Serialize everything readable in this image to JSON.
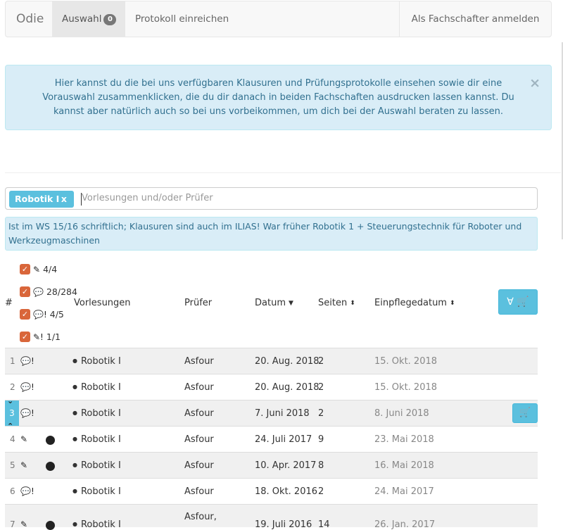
{
  "navbar": {
    "brand": "Odie",
    "auswahl_label": "Auswahl",
    "auswahl_count": "0",
    "protokoll_label": "Protokoll einreichen",
    "fachschafter_label": "Als Fachschafter anmelden"
  },
  "alert": {
    "text": "Hier kannst du die bei uns verfügbaren Klausuren und Prüfungsprotokolle einsehen sowie dir eine Vorauswahl zusammenklicken, die du dir danach in beiden Fachschaften ausdrucken lassen kannst. Du kannst aber natürlich auch so bei uns vorbeikommen, um dich bei der Auswahl beraten zu lassen.",
    "close": "×"
  },
  "search": {
    "tag_label": "Robotik I",
    "tag_remove": "x",
    "placeholder": "Vorlesungen und/oder Prüfer"
  },
  "info_box": "Ist im WS 15/16 schriftlich; Klausuren sind auch im ILIAS! War früher Robotik 1 + Steuerungstechnik für Roboter und Werkzeugmaschinen",
  "filters": [
    {
      "icon": "pencil-icon",
      "glyph": "✎",
      "count": "4/4",
      "checked": true
    },
    {
      "icon": "comments-icon",
      "glyph": "💬",
      "count": "28/284",
      "checked": true
    },
    {
      "icon": "comments-exclamation-icon",
      "glyph": "💬!",
      "count": "4/5",
      "checked": true
    },
    {
      "icon": "pencil-exclamation-icon",
      "glyph": "✎!",
      "count": "1/1",
      "checked": true
    }
  ],
  "table": {
    "headers": {
      "num": "#",
      "vorlesungen": "Vorlesungen",
      "pruefer": "Prüfer",
      "datum": "Datum",
      "seiten": "Seiten",
      "einpflegedatum": "Einpflegedatum"
    },
    "add_all_glyph": "∀",
    "rows": [
      {
        "num": "1",
        "icon": "comments-exclamation-icon",
        "glyph": "💬!",
        "dot": false,
        "vorlesung": "Robotik I",
        "pruefer": "Asfour",
        "datum": "20. Aug. 2018",
        "seiten": "2",
        "einpflegedatum": "15. Okt. 2018"
      },
      {
        "num": "2",
        "icon": "comments-exclamation-icon",
        "glyph": "💬!",
        "dot": false,
        "vorlesung": "Robotik I",
        "pruefer": "Asfour",
        "datum": "20. Aug. 2018",
        "seiten": "2",
        "einpflegedatum": "15. Okt. 2018"
      },
      {
        "num": "3",
        "icon": "comments-exclamation-icon",
        "glyph": "💬!",
        "dot": false,
        "vorlesung": "Robotik I",
        "pruefer": "Asfour",
        "datum": "7. Juni 2018",
        "seiten": "2",
        "einpflegedatum": "8. Juni 2018",
        "hovered": true
      },
      {
        "num": "4",
        "icon": "pencil-icon",
        "glyph": "✎",
        "dot": true,
        "vorlesung": "Robotik I",
        "pruefer": "Asfour",
        "datum": "24. Juli 2017",
        "seiten": "9",
        "einpflegedatum": "23. Mai 2018"
      },
      {
        "num": "5",
        "icon": "pencil-icon",
        "glyph": "✎",
        "dot": true,
        "vorlesung": "Robotik I",
        "pruefer": "Asfour",
        "datum": "10. Apr. 2017",
        "seiten": "8",
        "einpflegedatum": "16. Mai 2018"
      },
      {
        "num": "6",
        "icon": "comments-exclamation-icon",
        "glyph": "💬!",
        "dot": false,
        "vorlesung": "Robotik I",
        "pruefer": "Asfour",
        "datum": "18. Okt. 2016",
        "seiten": "2",
        "einpflegedatum": "24. Mai 2017"
      },
      {
        "num": "7",
        "icon": "pencil-icon",
        "glyph": "✎",
        "dot": true,
        "vorlesung": "Robotik I",
        "pruefer": "Asfour,",
        "datum": "19. Juli 2016",
        "seiten": "14",
        "einpflegedatum": "26. Jan. 2017"
      }
    ]
  }
}
